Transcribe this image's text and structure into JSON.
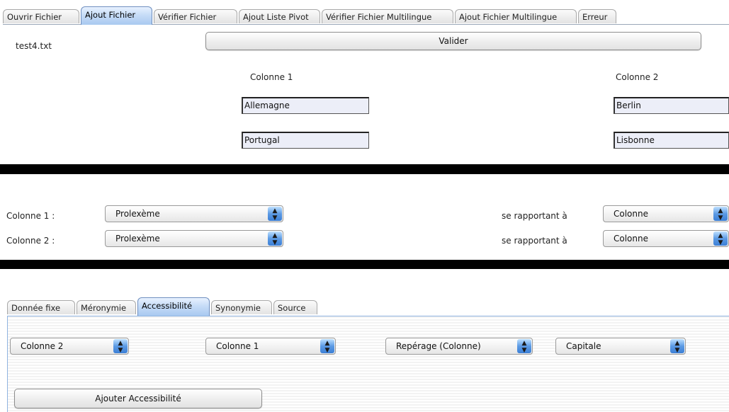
{
  "tabs": [
    {
      "label": "Ouvrir Fichier"
    },
    {
      "label": "Ajout Fichier"
    },
    {
      "label": "Vérifier Fichier"
    },
    {
      "label": "Ajout Liste Pivot"
    },
    {
      "label": "Vérifier Fichier Multilingue"
    },
    {
      "label": "Ajout Fichier Multilingue"
    },
    {
      "label": "Erreur"
    }
  ],
  "file": {
    "name": "test4.txt",
    "validate_label": "Valider"
  },
  "preview": {
    "col1_header": "Colonne 1",
    "col2_header": "Colonne 2",
    "rows": [
      {
        "col1": "Allemagne",
        "col2": "Berlin"
      },
      {
        "col1": "Portugal",
        "col2": "Lisbonne"
      }
    ]
  },
  "mapping": [
    {
      "label": "Colonne 1 :",
      "type": "Prolexème",
      "relates_label": "se rapportant à",
      "relates_value": "Colonne"
    },
    {
      "label": "Colonne 2 :",
      "type": "Prolexème",
      "relates_label": "se rapportant à",
      "relates_value": "Colonne"
    }
  ],
  "subtabs": [
    {
      "label": "Donnée fixe"
    },
    {
      "label": "Méronymie"
    },
    {
      "label": "Accessibilité"
    },
    {
      "label": "Synonymie"
    },
    {
      "label": "Source"
    }
  ],
  "accessibility": {
    "select1": "Colonne 2",
    "select2": "Colonne 1",
    "select3": "Repérage (Colonne)",
    "select4": "Capitale",
    "add_label": "Ajouter Accessibilité"
  }
}
